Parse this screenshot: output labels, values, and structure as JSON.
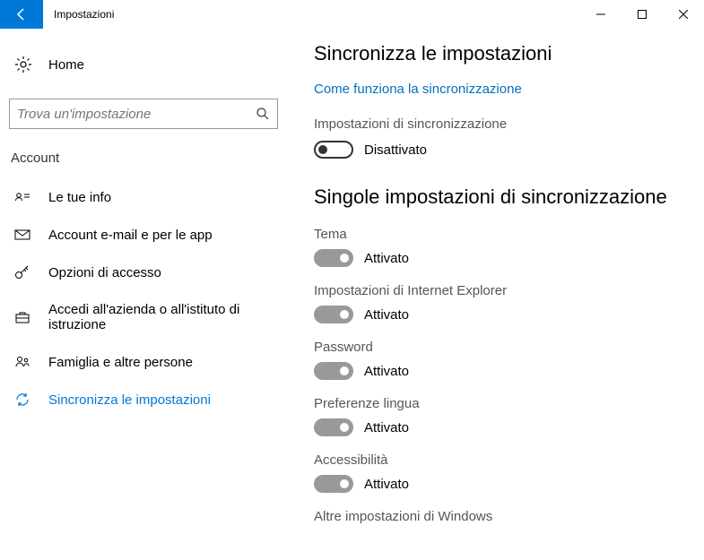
{
  "titlebar": {
    "title": "Impostazioni"
  },
  "sidebar": {
    "home_label": "Home",
    "search_placeholder": "Trova un'impostazione",
    "section_label": "Account",
    "items": [
      {
        "label": "Le tue info"
      },
      {
        "label": "Account e-mail e per le app"
      },
      {
        "label": "Opzioni di accesso"
      },
      {
        "label": "Accedi all'azienda o all'istituto di istruzione"
      },
      {
        "label": "Famiglia e altre persone"
      },
      {
        "label": "Sincronizza le impostazioni"
      }
    ]
  },
  "main": {
    "heading": "Sincronizza le impostazioni",
    "link": "Come funziona la sincronizzazione",
    "sync_settings_label": "Impostazioni di sincronizzazione",
    "sync_settings_status": "Disattivato",
    "section_heading": "Singole impostazioni di sincronizzazione",
    "toggles": [
      {
        "label": "Tema",
        "status": "Attivato"
      },
      {
        "label": "Impostazioni di Internet Explorer",
        "status": "Attivato"
      },
      {
        "label": "Password",
        "status": "Attivato"
      },
      {
        "label": "Preferenze lingua",
        "status": "Attivato"
      },
      {
        "label": "Accessibilità",
        "status": "Attivato"
      }
    ],
    "footer_label": "Altre impostazioni di Windows"
  }
}
